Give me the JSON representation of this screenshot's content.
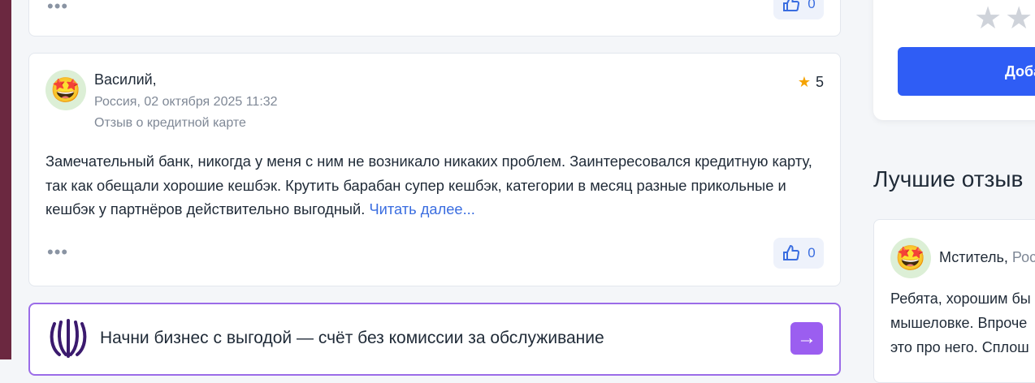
{
  "previous_review": {
    "likes": "0"
  },
  "review": {
    "author": "Василий,",
    "location_date": "Россия, 02 октября 2025 11:32",
    "review_type": "Отзыв о кредитной карте",
    "rating": "5",
    "text": "Замечательный банк, никогда у меня с ним не возникало никаких проблем. Заинтересовался кредитную карту, так как обещали хорошие кешбэк. Крутить барабан супер кешбэк, категории в месяц разные прикольные и кешбэк у партнёров действительно выгодный.",
    "read_more": "Читать далее...",
    "likes": "0"
  },
  "ad": {
    "text": "Начни бизнес с выгодой — счёт без комиссии за обслуживание"
  },
  "sidebar": {
    "add_button": "Доба",
    "best_reviews_title": "Лучшие отзыв",
    "best_review": {
      "author": "Мститель,",
      "location": "Рос",
      "lines": [
        "Ребята, хорошим бы",
        "мышеловке. Впроче",
        "это про него. Сплош"
      ]
    }
  },
  "colors": {
    "accent": "#3a6de0",
    "star": "#f5a300",
    "ad_border": "#9b6ce8",
    "primary_button": "#2f5df5"
  }
}
